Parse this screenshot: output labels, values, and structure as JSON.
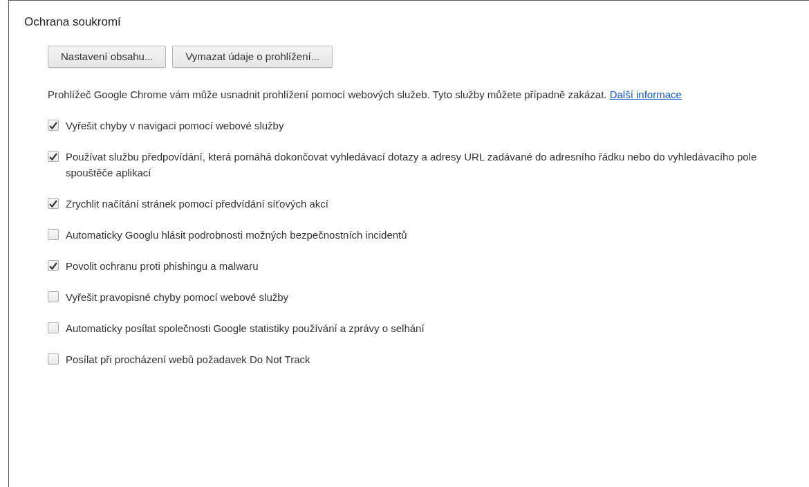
{
  "section": {
    "title": "Ochrana soukromí"
  },
  "buttons": [
    "Nastavení obsahu...",
    "Vymazat údaje o prohlížení..."
  ],
  "description": {
    "text": "Prohlížeč Google Chrome vám může usnadnit prohlížení pomocí webových služeb. Tyto služby můžete případně zakázat.",
    "link": "Další informace"
  },
  "options": [
    {
      "label": "Vyřešit chyby v navigaci pomocí webové služby",
      "checked": true
    },
    {
      "label": "Používat službu předpovídání, která pomáhá dokončovat vyhledávací dotazy a adresy URL zadávané do adresního řádku nebo do vyhledávacího pole spouštěče aplikací",
      "checked": true
    },
    {
      "label": "Zrychlit načítání stránek pomocí předvídání síťových akcí",
      "checked": true
    },
    {
      "label": "Automaticky Googlu hlásit podrobnosti možných bezpečnostních incidentů",
      "checked": false
    },
    {
      "label": "Povolit ochranu proti phishingu a malwaru",
      "checked": true
    },
    {
      "label": "Vyřešit pravopisné chyby pomocí webové služby",
      "checked": false
    },
    {
      "label": "Automaticky posílat společnosti Google statistiky používání a zprávy o selhání",
      "checked": false
    },
    {
      "label": "Posílat při procházení webů požadavek Do Not Track",
      "checked": false
    }
  ]
}
